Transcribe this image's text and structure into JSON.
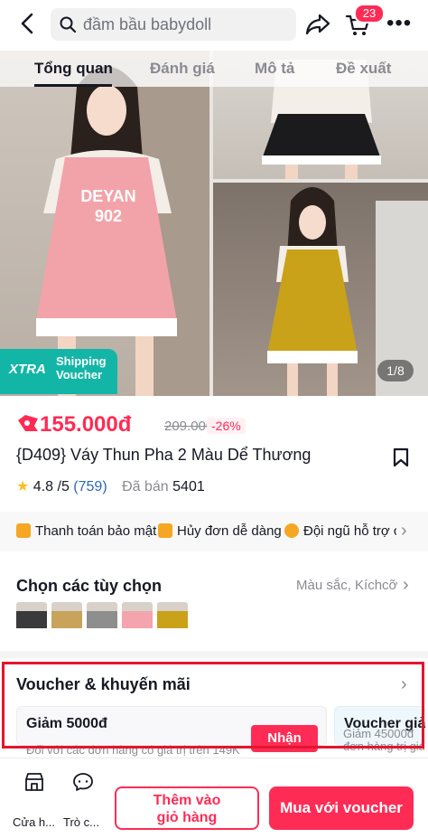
{
  "header": {
    "search_text": "đầm bầu babydoll",
    "cart_count": "23",
    "icons": [
      "back-icon",
      "search-icon",
      "share-icon",
      "cart-icon",
      "more-icon"
    ]
  },
  "tabs": [
    {
      "label": "Tổng quan",
      "active": true
    },
    {
      "label": "Đánh giá",
      "active": false
    },
    {
      "label": "Mô tả",
      "active": false
    },
    {
      "label": "Đề xuất",
      "active": false
    }
  ],
  "gallery": {
    "badge_brand": "XTRA",
    "badge_text": "Shipping Voucher",
    "counter": "1/8",
    "print_text_1": "DEYAN",
    "print_text_2": "902"
  },
  "product": {
    "price": "155.000đ",
    "original_price": "209.000đ",
    "discount": "-26%",
    "title": "{D409} Váy Thun Pha 2 Màu Dể Thương",
    "rating": "4.8",
    "rating_max": "/5",
    "review_count": "(759)",
    "sold_label": "Đã bán",
    "sold_count": "5401"
  },
  "features": [
    {
      "label": "Thanh toán bảo mật",
      "color": "#f5a623"
    },
    {
      "label": "Hủy đơn dễ dàng",
      "color": "#f5a623"
    },
    {
      "label": "Đội ngũ hỗ trợ c",
      "color": "#f5a623"
    }
  ],
  "options": {
    "title": "Chọn các tùy chọn",
    "summary": "Màu sắc, Kíchcỡ",
    "swatches": [
      "#3a3a3a",
      "#c9a25c",
      "#8e8e8e",
      "#f4a4ad",
      "#c9a21a"
    ]
  },
  "voucher": {
    "title": "Voucher & khuyến mãi",
    "card1_name": "Giảm 5000đ",
    "card1_desc": "Đối với các đơn hàng có giá trị trên 149K",
    "card1_button": "Nhận",
    "card2_name": "Voucher giả",
    "card2_desc_1": "Giảm 45000đ",
    "card2_desc_2": "đơn hàng trị giá"
  },
  "bottom_bar": {
    "shop_label": "Cửa h...",
    "chat_label": "Trò c...",
    "add_to_cart_line1": "Thêm vào",
    "add_to_cart_line2": "giỏ hàng",
    "buy_label": "Mua với voucher"
  },
  "colors": {
    "accent": "#fe2c55",
    "xtra_teal": "#13b6a6",
    "highlight_border": "#e3162e"
  }
}
